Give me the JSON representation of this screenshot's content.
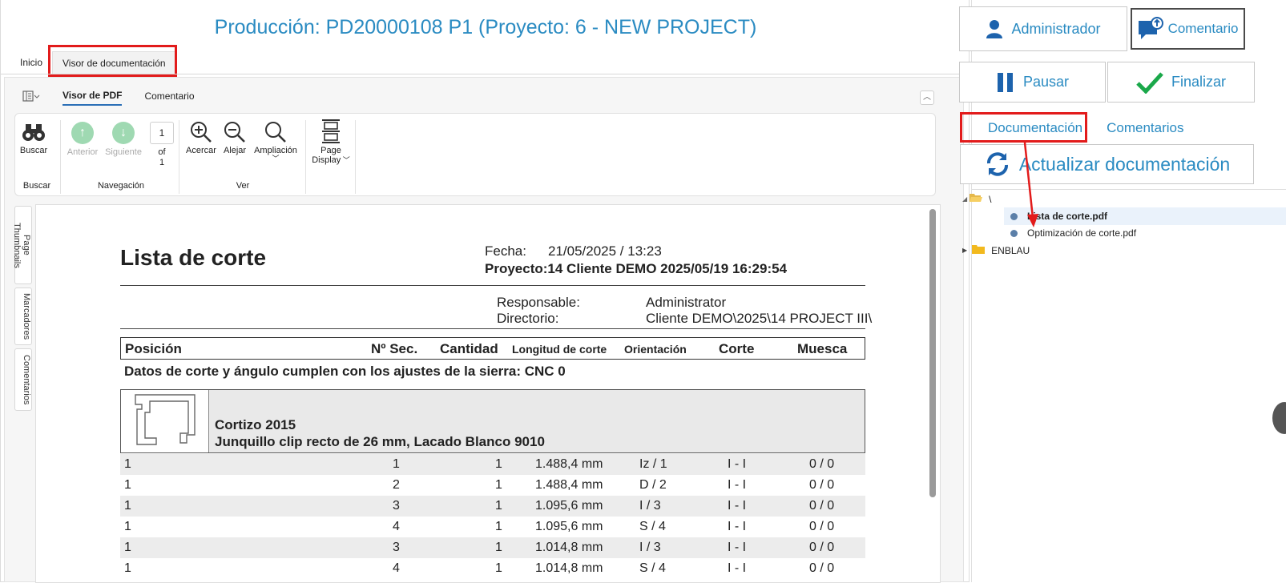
{
  "title": "Producción: PD20000108 P1 (Proyecto: 6 - NEW PROJECT)",
  "top_tabs": [
    "Inicio",
    "Visor de documentación"
  ],
  "viewer": {
    "tabs": [
      "Visor de PDF",
      "Comentario"
    ],
    "ribbon": {
      "search": {
        "label": "Buscar",
        "group": "Buscar"
      },
      "prev": "Anterior",
      "next": "Siguiente",
      "page_value": "1",
      "of_label": "of",
      "page_total": "1",
      "nav_group": "Navegación",
      "zoom_in": "Acercar",
      "zoom_out": "Alejar",
      "zoom": "Ampliación",
      "view_group": "Ver",
      "page_display_1": "Page",
      "page_display_2": "Display"
    },
    "side_tabs": [
      "Page Thumbnails",
      "Marcadores",
      "Comentarios"
    ]
  },
  "pdf": {
    "heading": "Lista de corte",
    "fecha_label": "Fecha:",
    "fecha_value": "21/05/2025 / 13:23",
    "proyecto_line": "Proyecto:14 Cliente DEMO 2025/05/19 16:29:54",
    "responsable_label": "Responsable:",
    "responsable_value": "Administrator",
    "directorio_label": "Directorio:",
    "directorio_value": "Cliente DEMO\\2025\\14 PROJECT III\\",
    "columns": [
      "Posición",
      "Nº Sec.",
      "Cantidad",
      "Longitud de corte",
      "Orientación",
      "Corte",
      "Muesca"
    ],
    "note": "Datos de corte y ángulo cumplen con los ajustes de la sierra: CNC 0",
    "profile_name": "Cortizo 2015",
    "profile_desc": "Junquillo clip recto de 26 mm, Lacado Blanco 9010",
    "rows": [
      [
        "1",
        "1",
        "1",
        "1.488,4 mm",
        "Iz / 1",
        "I - I",
        "0 / 0"
      ],
      [
        "1",
        "2",
        "1",
        "1.488,4 mm",
        "D / 2",
        "I - I",
        "0 / 0"
      ],
      [
        "1",
        "3",
        "1",
        "1.095,6 mm",
        "I / 3",
        "I - I",
        "0 / 0"
      ],
      [
        "1",
        "4",
        "1",
        "1.095,6 mm",
        "S / 4",
        "I - I",
        "0 / 0"
      ],
      [
        "1",
        "3",
        "1",
        "1.014,8 mm",
        "I / 3",
        "I - I",
        "0 / 0"
      ],
      [
        "1",
        "4",
        "1",
        "1.014,8 mm",
        "S / 4",
        "I - I",
        "0 / 0"
      ]
    ]
  },
  "right": {
    "user": "Administrador",
    "comment_button": "Comentario",
    "pause": "Pausar",
    "finish": "Finalizar",
    "tabs": [
      "Documentación",
      "Comentarios"
    ],
    "refresh": "Actualizar documentación",
    "tree": {
      "root": "\\",
      "files": [
        "Lista de corte.pdf",
        "Optimización de corte.pdf"
      ],
      "folder": "ENBLAU"
    }
  },
  "colors": {
    "accent": "#2a8bc2",
    "highlight": "#e21b1b",
    "ok_green": "#1aa84a"
  }
}
